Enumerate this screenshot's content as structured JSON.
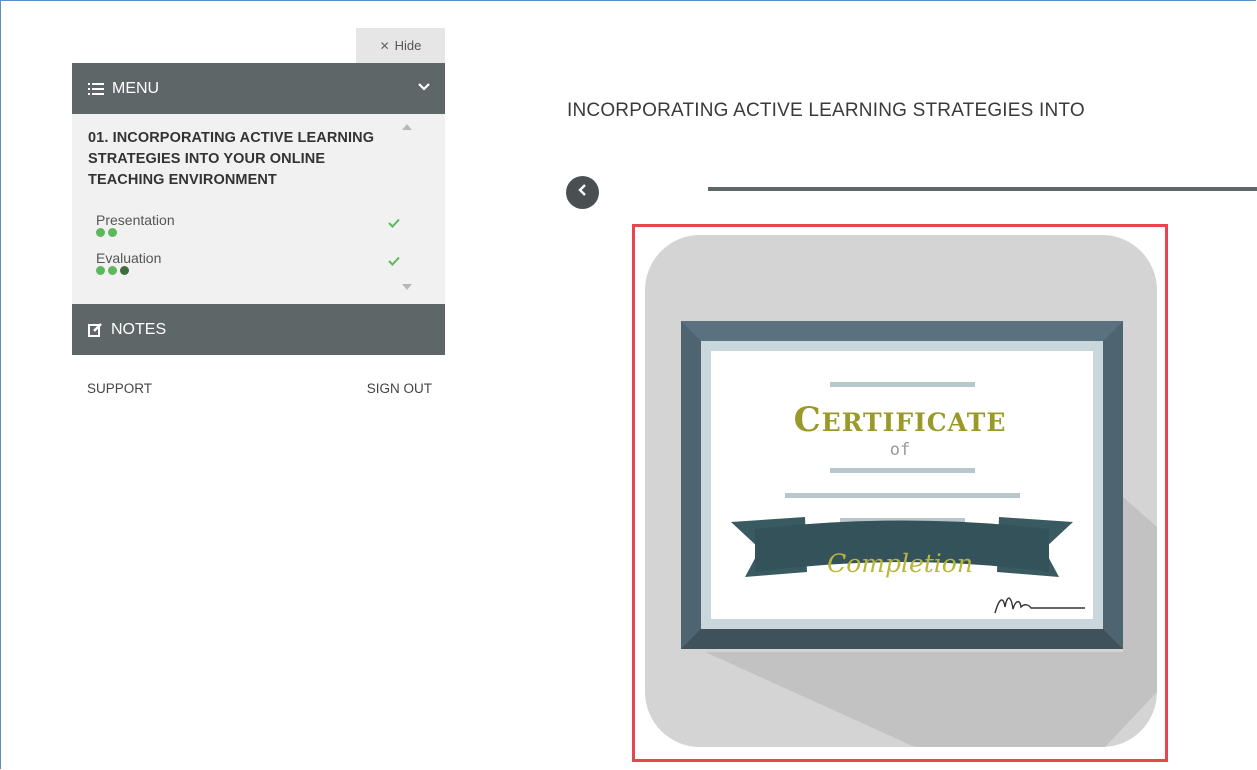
{
  "sidebar": {
    "hide_label": "Hide",
    "menu_label": "MENU",
    "notes_label": "NOTES",
    "course_title": "01. INCORPORATING ACTIVE LEARNING STRATEGIES INTO YOUR ONLINE TEACHING ENVIRONMENT",
    "lessons": [
      {
        "label": "Presentation",
        "completed_dots": 2,
        "total_dots": 2,
        "status": "complete"
      },
      {
        "label": "Evaluation",
        "completed_dots": 3,
        "total_dots": 3,
        "status": "complete"
      }
    ],
    "support_label": "SUPPORT",
    "signout_label": "SIGN OUT"
  },
  "main": {
    "title": "INCORPORATING ACTIVE LEARNING STRATEGIES INTO",
    "certificate": {
      "title_initial": "C",
      "title_rest": "ERTIFICATE",
      "of": "of",
      "ribbon": "Completion",
      "signature": "Mann"
    }
  },
  "colors": {
    "header_bg": "#5f6668",
    "check": "#5cb85c",
    "highlight_border": "#e8454f",
    "frame": "#4e6470",
    "ribbon": "#3a5a62",
    "certificate_text": "#9a9a2a"
  },
  "icons": {
    "menu": "list-icon",
    "menu_toggle": "chevron-down-icon",
    "notes": "edit-icon",
    "back": "chevron-left-icon",
    "lesson_status": "check-icon",
    "hide": "close-icon"
  }
}
